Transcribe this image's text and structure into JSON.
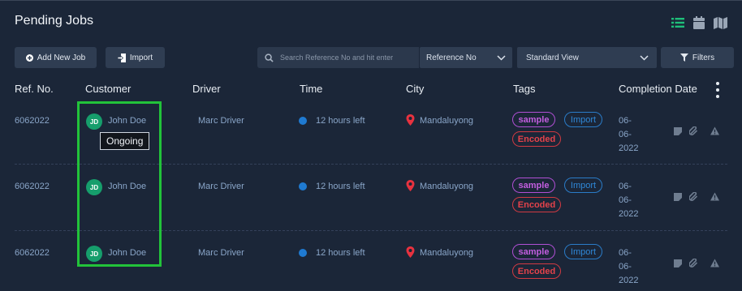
{
  "page": {
    "title": "Pending Jobs"
  },
  "view_icons": [
    {
      "name": "list-view-icon",
      "color": "#1fbf7a"
    },
    {
      "name": "calendar-view-icon",
      "color": "#9aa6b6"
    },
    {
      "name": "map-view-icon",
      "color": "#9aa6b6"
    }
  ],
  "toolbar": {
    "add_job_label": "Add New Job",
    "import_label": "Import",
    "search_placeholder": "Search Reference No and hit enter",
    "search_field_select": "Reference No",
    "view_select": "Standard View",
    "filters_label": "Filters"
  },
  "table": {
    "columns": [
      "Ref. No.",
      "Customer",
      "Driver",
      "Time",
      "City",
      "Tags",
      "Completion Date"
    ],
    "rows": [
      {
        "ref": "6062022",
        "customer_initials": "JD",
        "customer": "John Doe",
        "driver": "Marc Driver",
        "time": "12 hours left",
        "city": "Mandaluyong",
        "tags": [
          "sample",
          "Import",
          "Encoded"
        ],
        "completion_date": [
          "06-",
          "06-",
          "2022"
        ]
      },
      {
        "ref": "6062022",
        "customer_initials": "JD",
        "customer": "John Doe",
        "driver": "Marc Driver",
        "time": "12 hours left",
        "city": "Mandaluyong",
        "tags": [
          "sample",
          "Import",
          "Encoded"
        ],
        "completion_date": [
          "06-",
          "06-",
          "2022"
        ]
      },
      {
        "ref": "6062022",
        "customer_initials": "JD",
        "customer": "John Doe",
        "driver": "Marc Driver",
        "time": "12 hours left",
        "city": "Mandaluyong",
        "tags": [
          "sample",
          "Import",
          "Encoded"
        ],
        "completion_date": [
          "06-",
          "06-",
          "2022"
        ]
      }
    ]
  },
  "tooltip": {
    "text": "Ongoing"
  },
  "colors": {
    "background": "#1b2638",
    "highlight": "#22c33a",
    "avatar": "#169e6c",
    "tag_sample": "#c35ee0",
    "tag_import": "#2f88d8",
    "tag_encoded": "#e3424a",
    "status_dot": "#1f7ad1"
  }
}
